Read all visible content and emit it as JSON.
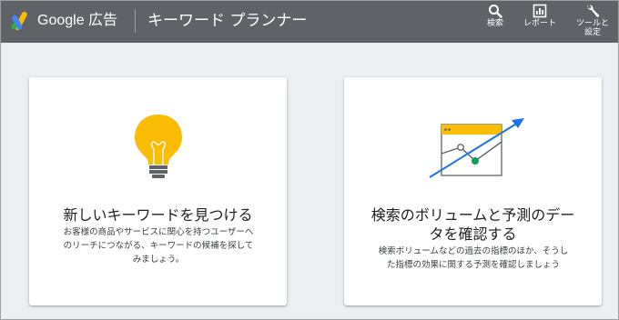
{
  "header": {
    "brand": "Google 広告",
    "tool_title": "キーワード プランナー",
    "actions": [
      {
        "label": "検索",
        "icon": "search-icon"
      },
      {
        "label": "レポート",
        "icon": "reports-icon"
      },
      {
        "label_line1": "ツールと",
        "label_line2": "設定",
        "icon": "wrench-icon"
      }
    ]
  },
  "cards": [
    {
      "title": "新しいキーワードを見つける",
      "description_lines": [
        "お客様の商品やサービスに関心を持つユーザーへ",
        "のリーチにつながる、キーワードの候補を探して",
        "みましょう。"
      ],
      "icon": "lightbulb-icon"
    },
    {
      "title_lines": [
        "検索のボリュームと予測のデー",
        "タを確認する"
      ],
      "description_lines": [
        "検索ボリュームなどの過去の指標のほか、そうし",
        "た指標の効果に関する予測を確認しましょう"
      ],
      "icon": "forecast-chart-icon"
    }
  ],
  "colors": {
    "header_bg": "#5f6368",
    "page_bg": "#eceff1",
    "bulb": "#fbbc04",
    "accent_blue": "#1a73e8",
    "point_green": "#0f9d58"
  }
}
